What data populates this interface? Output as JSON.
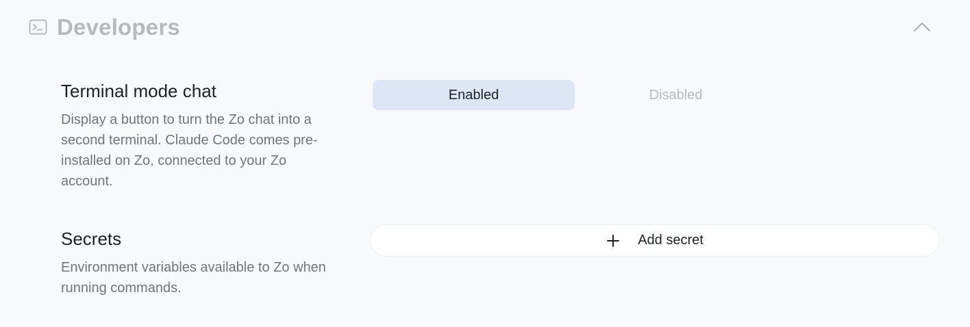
{
  "section": {
    "title": "Developers",
    "icon": "terminal-icon",
    "collapse_icon": "chevron-up-icon"
  },
  "terminal_mode": {
    "title": "Terminal mode chat",
    "description": "Display a button to turn the Zo chat into a second terminal. Claude Code comes pre-installed on Zo, connected to your Zo account.",
    "options": [
      "Enabled",
      "Disabled"
    ],
    "selected": "Enabled"
  },
  "secrets": {
    "title": "Secrets",
    "description": "Environment variables available to Zo when running commands.",
    "add_label": "Add secret",
    "add_icon": "plus-icon"
  },
  "colors": {
    "background": "#f8f9fb",
    "selected_segment": "#dde6f5",
    "muted_text": "#b6b9be",
    "body_text": "#70747c",
    "heading_text": "#1e2024"
  }
}
